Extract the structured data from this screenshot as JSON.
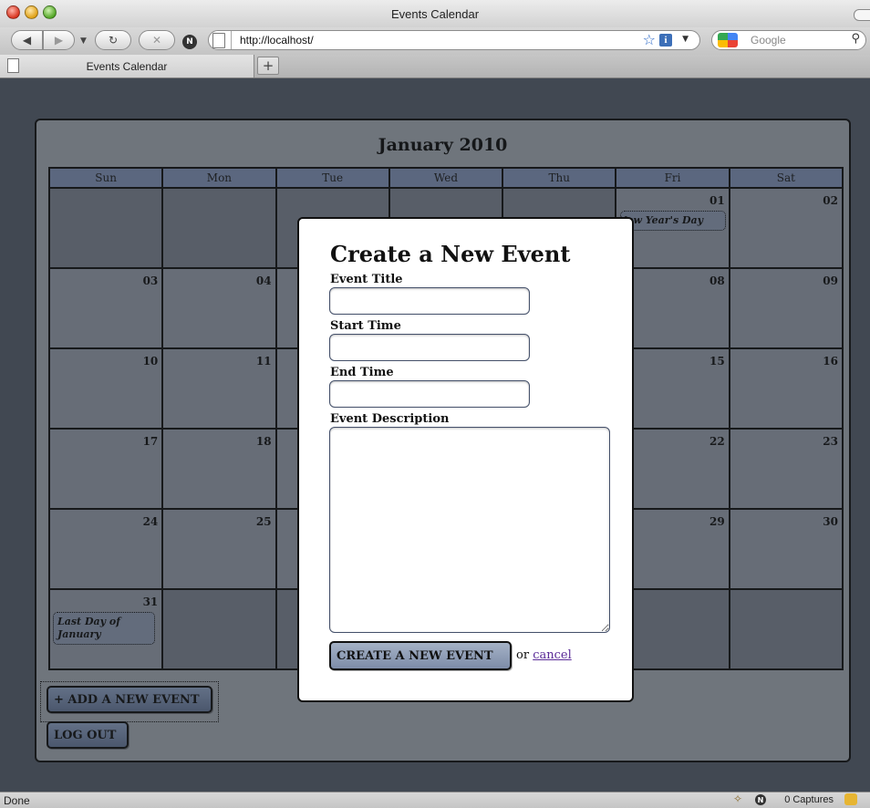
{
  "browser": {
    "window_title": "Events Calendar",
    "url": "http://localhost/",
    "search_placeholder": "Google",
    "tab_title": "Events Calendar",
    "status_text": "Done",
    "captures_text": "0 Captures"
  },
  "calendar": {
    "month_title": "January 2010",
    "weekdays": [
      "Sun",
      "Mon",
      "Tue",
      "Wed",
      "Thu",
      "Fri",
      "Sat"
    ],
    "days": {
      "d01": "01",
      "d02": "02",
      "d03": "03",
      "d04": "04",
      "d08": "08",
      "d09": "09",
      "d10": "10",
      "d11": "11",
      "d15": "15",
      "d16": "16",
      "d17": "17",
      "d18": "18",
      "d22": "22",
      "d23": "23",
      "d24": "24",
      "d25": "25",
      "d29": "29",
      "d30": "30",
      "d31": "31"
    },
    "events": {
      "new_years": "New Year's Day",
      "last_day": "Last Day of January"
    }
  },
  "actions": {
    "add_event": "+ ADD A NEW EVENT",
    "log_out": "LOG OUT"
  },
  "modal": {
    "title": "Create a New Event",
    "event_title_label": "Event Title",
    "start_time_label": "Start Time",
    "end_time_label": "End Time",
    "description_label": "Event Description",
    "event_title_value": "",
    "start_time_value": "",
    "end_time_value": "",
    "description_value": "",
    "submit_label": "CREATE A NEW EVENT",
    "or_text": "or",
    "cancel_label": "cancel"
  }
}
